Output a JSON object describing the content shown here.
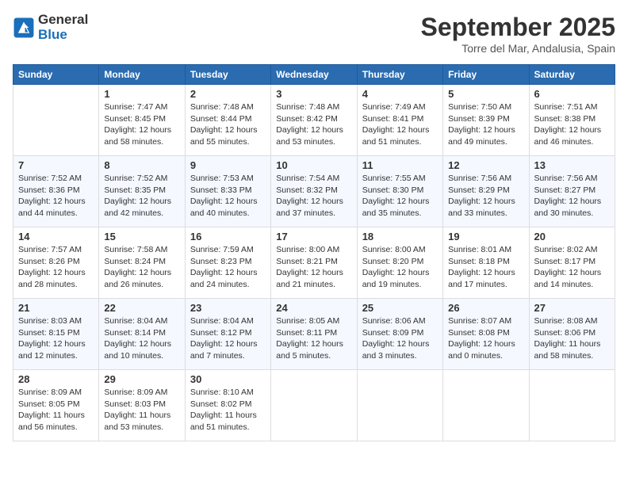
{
  "logo": {
    "line1": "General",
    "line2": "Blue"
  },
  "title": "September 2025",
  "location": "Torre del Mar, Andalusia, Spain",
  "days_header": [
    "Sunday",
    "Monday",
    "Tuesday",
    "Wednesday",
    "Thursday",
    "Friday",
    "Saturday"
  ],
  "weeks": [
    [
      {
        "day": "",
        "info": ""
      },
      {
        "day": "1",
        "info": "Sunrise: 7:47 AM\nSunset: 8:45 PM\nDaylight: 12 hours\nand 58 minutes."
      },
      {
        "day": "2",
        "info": "Sunrise: 7:48 AM\nSunset: 8:44 PM\nDaylight: 12 hours\nand 55 minutes."
      },
      {
        "day": "3",
        "info": "Sunrise: 7:48 AM\nSunset: 8:42 PM\nDaylight: 12 hours\nand 53 minutes."
      },
      {
        "day": "4",
        "info": "Sunrise: 7:49 AM\nSunset: 8:41 PM\nDaylight: 12 hours\nand 51 minutes."
      },
      {
        "day": "5",
        "info": "Sunrise: 7:50 AM\nSunset: 8:39 PM\nDaylight: 12 hours\nand 49 minutes."
      },
      {
        "day": "6",
        "info": "Sunrise: 7:51 AM\nSunset: 8:38 PM\nDaylight: 12 hours\nand 46 minutes."
      }
    ],
    [
      {
        "day": "7",
        "info": "Sunrise: 7:52 AM\nSunset: 8:36 PM\nDaylight: 12 hours\nand 44 minutes."
      },
      {
        "day": "8",
        "info": "Sunrise: 7:52 AM\nSunset: 8:35 PM\nDaylight: 12 hours\nand 42 minutes."
      },
      {
        "day": "9",
        "info": "Sunrise: 7:53 AM\nSunset: 8:33 PM\nDaylight: 12 hours\nand 40 minutes."
      },
      {
        "day": "10",
        "info": "Sunrise: 7:54 AM\nSunset: 8:32 PM\nDaylight: 12 hours\nand 37 minutes."
      },
      {
        "day": "11",
        "info": "Sunrise: 7:55 AM\nSunset: 8:30 PM\nDaylight: 12 hours\nand 35 minutes."
      },
      {
        "day": "12",
        "info": "Sunrise: 7:56 AM\nSunset: 8:29 PM\nDaylight: 12 hours\nand 33 minutes."
      },
      {
        "day": "13",
        "info": "Sunrise: 7:56 AM\nSunset: 8:27 PM\nDaylight: 12 hours\nand 30 minutes."
      }
    ],
    [
      {
        "day": "14",
        "info": "Sunrise: 7:57 AM\nSunset: 8:26 PM\nDaylight: 12 hours\nand 28 minutes."
      },
      {
        "day": "15",
        "info": "Sunrise: 7:58 AM\nSunset: 8:24 PM\nDaylight: 12 hours\nand 26 minutes."
      },
      {
        "day": "16",
        "info": "Sunrise: 7:59 AM\nSunset: 8:23 PM\nDaylight: 12 hours\nand 24 minutes."
      },
      {
        "day": "17",
        "info": "Sunrise: 8:00 AM\nSunset: 8:21 PM\nDaylight: 12 hours\nand 21 minutes."
      },
      {
        "day": "18",
        "info": "Sunrise: 8:00 AM\nSunset: 8:20 PM\nDaylight: 12 hours\nand 19 minutes."
      },
      {
        "day": "19",
        "info": "Sunrise: 8:01 AM\nSunset: 8:18 PM\nDaylight: 12 hours\nand 17 minutes."
      },
      {
        "day": "20",
        "info": "Sunrise: 8:02 AM\nSunset: 8:17 PM\nDaylight: 12 hours\nand 14 minutes."
      }
    ],
    [
      {
        "day": "21",
        "info": "Sunrise: 8:03 AM\nSunset: 8:15 PM\nDaylight: 12 hours\nand 12 minutes."
      },
      {
        "day": "22",
        "info": "Sunrise: 8:04 AM\nSunset: 8:14 PM\nDaylight: 12 hours\nand 10 minutes."
      },
      {
        "day": "23",
        "info": "Sunrise: 8:04 AM\nSunset: 8:12 PM\nDaylight: 12 hours\nand 7 minutes."
      },
      {
        "day": "24",
        "info": "Sunrise: 8:05 AM\nSunset: 8:11 PM\nDaylight: 12 hours\nand 5 minutes."
      },
      {
        "day": "25",
        "info": "Sunrise: 8:06 AM\nSunset: 8:09 PM\nDaylight: 12 hours\nand 3 minutes."
      },
      {
        "day": "26",
        "info": "Sunrise: 8:07 AM\nSunset: 8:08 PM\nDaylight: 12 hours\nand 0 minutes."
      },
      {
        "day": "27",
        "info": "Sunrise: 8:08 AM\nSunset: 8:06 PM\nDaylight: 11 hours\nand 58 minutes."
      }
    ],
    [
      {
        "day": "28",
        "info": "Sunrise: 8:09 AM\nSunset: 8:05 PM\nDaylight: 11 hours\nand 56 minutes."
      },
      {
        "day": "29",
        "info": "Sunrise: 8:09 AM\nSunset: 8:03 PM\nDaylight: 11 hours\nand 53 minutes."
      },
      {
        "day": "30",
        "info": "Sunrise: 8:10 AM\nSunset: 8:02 PM\nDaylight: 11 hours\nand 51 minutes."
      },
      {
        "day": "",
        "info": ""
      },
      {
        "day": "",
        "info": ""
      },
      {
        "day": "",
        "info": ""
      },
      {
        "day": "",
        "info": ""
      }
    ]
  ]
}
